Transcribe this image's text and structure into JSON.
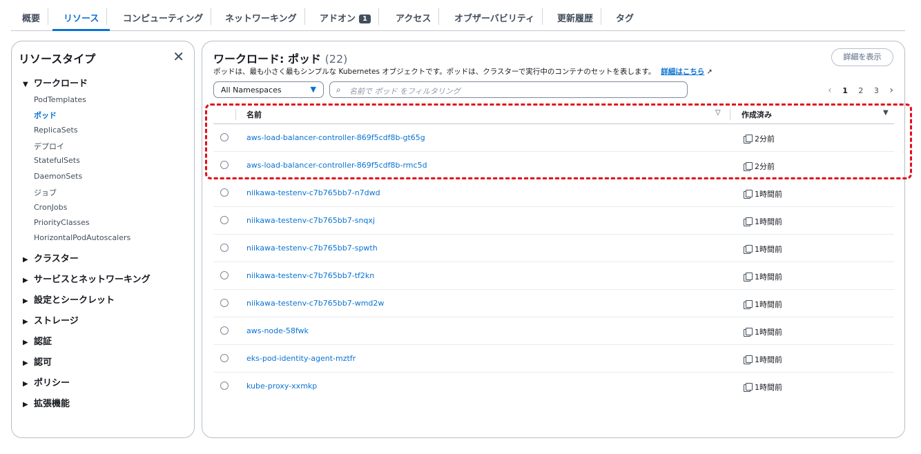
{
  "tabs": [
    {
      "label": "概要"
    },
    {
      "label": "リソース"
    },
    {
      "label": "コンピューティング"
    },
    {
      "label": "ネットワーキング"
    },
    {
      "label": "アドオン",
      "badge": "1"
    },
    {
      "label": "アクセス"
    },
    {
      "label": "オブザーバビリティ"
    },
    {
      "label": "更新履歴"
    },
    {
      "label": "タグ"
    }
  ],
  "active_tab": "リソース",
  "sidebar": {
    "title": "リソースタイプ",
    "close_icon": "close-icon",
    "workload_section": "ワークロード",
    "workload_items": [
      "PodTemplates",
      "ポッド",
      "ReplicaSets",
      "デプロイ",
      "StatefulSets",
      "DaemonSets",
      "ジョブ",
      "CronJobs",
      "PriorityClasses",
      "HorizontalPodAutoscalers"
    ],
    "active_item": "ポッド",
    "sections": [
      "クラスター",
      "サービスとネットワーキング",
      "設定とシークレット",
      "ストレージ",
      "認証",
      "認可",
      "ポリシー",
      "拡張機能"
    ]
  },
  "main": {
    "title": "ワークロード: ポッド",
    "count": "(22)",
    "description": "ポッドは、最も小さく最もシンプルな Kubernetes オブジェクトです。ポッドは、クラスターで実行中のコンテナのセットを表します。",
    "learn_more": "詳細はこちら",
    "details_button": "詳細を表示",
    "namespace_select": "All Namespaces",
    "filter_placeholder": "名前で ポッド をフィルタリング",
    "pagination": {
      "pages": [
        "1",
        "2",
        "3"
      ],
      "current": "1"
    },
    "columns": {
      "name": "名前",
      "created": "作成済み"
    },
    "rows": [
      {
        "name": "aws-load-balancer-controller-869f5cdf8b-gt65g",
        "created": "2分前"
      },
      {
        "name": "aws-load-balancer-controller-869f5cdf8b-rmc5d",
        "created": "2分前"
      },
      {
        "name": "niikawa-testenv-c7b765bb7-n7dwd",
        "created": "1時間前"
      },
      {
        "name": "niikawa-testenv-c7b765bb7-snqxj",
        "created": "1時間前"
      },
      {
        "name": "niikawa-testenv-c7b765bb7-spwth",
        "created": "1時間前"
      },
      {
        "name": "niikawa-testenv-c7b765bb7-tf2kn",
        "created": "1時間前"
      },
      {
        "name": "niikawa-testenv-c7b765bb7-wmd2w",
        "created": "1時間前"
      },
      {
        "name": "aws-node-58fwk",
        "created": "1時間前"
      },
      {
        "name": "eks-pod-identity-agent-mztfr",
        "created": "1時間前"
      },
      {
        "name": "kube-proxy-xxmkp",
        "created": "1時間前"
      }
    ]
  },
  "colors": {
    "accent": "#0972d3",
    "highlight": "#e0101a",
    "border": "#b6bec9"
  }
}
